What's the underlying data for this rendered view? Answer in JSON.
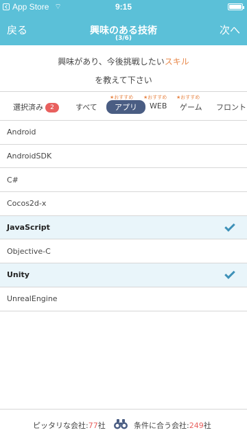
{
  "status_bar": {
    "app": "App Store",
    "time": "9:15"
  },
  "nav": {
    "back_label": "戻る",
    "title": "興味のある技術",
    "subtitle": "(3/6)",
    "next_label": "次へ"
  },
  "instruction": {
    "line1_prefix": "興味があり、今後挑戦したい",
    "line1_accent": "スキル",
    "line2": "を教えて下さい"
  },
  "tabs": {
    "selected_label": "選択済み",
    "selected_count": "2",
    "all_label": "すべて",
    "app_label": "アプリ",
    "web_label": "WEB",
    "game_label": "ゲーム",
    "front_label": "フロント",
    "recommend_label": "★おすすめ"
  },
  "list": [
    {
      "label": "Android",
      "selected": false
    },
    {
      "label": "AndroidSDK",
      "selected": false
    },
    {
      "label": "C#",
      "selected": false
    },
    {
      "label": "Cocos2d-x",
      "selected": false
    },
    {
      "label": "JavaScript",
      "selected": true
    },
    {
      "label": "Objective-C",
      "selected": false
    },
    {
      "label": "Unity",
      "selected": true
    },
    {
      "label": "UnrealEngine",
      "selected": false
    }
  ],
  "footer": {
    "perfect_prefix": "ピッタリな会社:",
    "perfect_count": "77",
    "perfect_suffix": "社",
    "match_prefix": "条件に合う会社:",
    "match_count": "249",
    "match_suffix": "社"
  },
  "colors": {
    "header": "#5bc0d8",
    "accent": "#e8884a",
    "badge": "#e8605e",
    "active_tab": "#4a5d83",
    "selected_row": "#e9f5fa",
    "check": "#3e91b8"
  }
}
